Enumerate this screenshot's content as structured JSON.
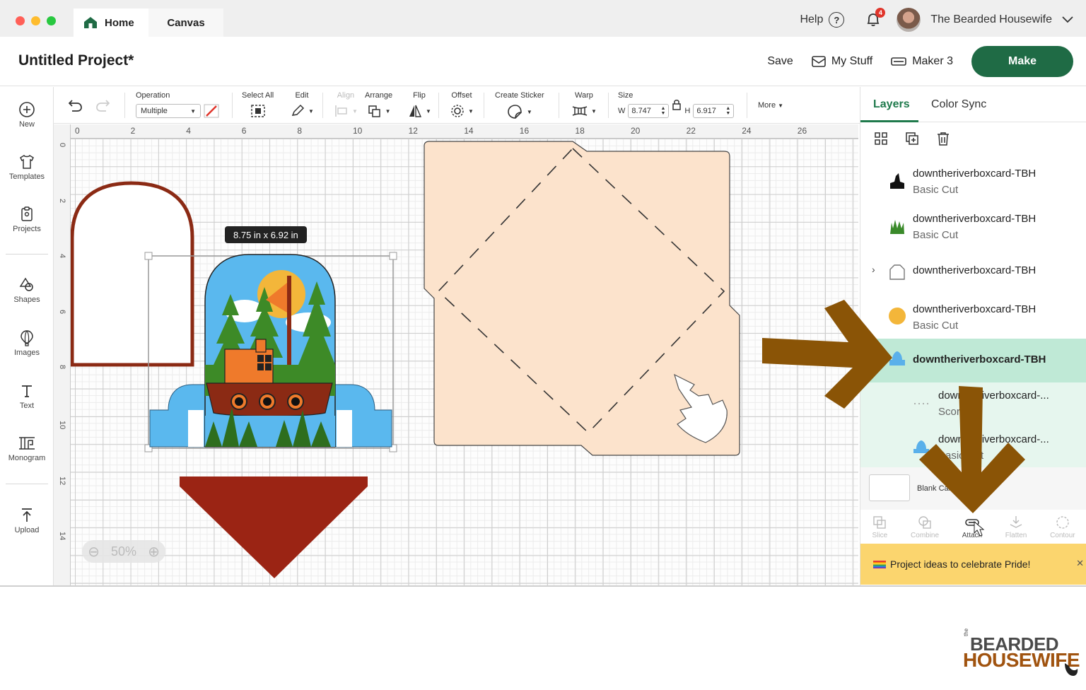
{
  "tabbar": {
    "home_label": "Home",
    "canvas_label": "Canvas",
    "help_label": "Help",
    "notification_count": "4",
    "user_name": "The Bearded Housewife"
  },
  "header": {
    "project_title": "Untitled Project*",
    "save_label": "Save",
    "mystuff_label": "My Stuff",
    "machine_label": "Maker 3",
    "make_label": "Make"
  },
  "sidebar": {
    "items": [
      {
        "label": "New"
      },
      {
        "label": "Templates"
      },
      {
        "label": "Projects"
      },
      {
        "label": "Shapes"
      },
      {
        "label": "Images"
      },
      {
        "label": "Text"
      },
      {
        "label": "Monogram"
      },
      {
        "label": "Upload"
      }
    ]
  },
  "toolbar": {
    "operation_label": "Operation",
    "operation_value": "Multiple",
    "selectall_label": "Select All",
    "edit_label": "Edit",
    "align_label": "Align",
    "arrange_label": "Arrange",
    "flip_label": "Flip",
    "offset_label": "Offset",
    "sticker_label": "Create Sticker",
    "warp_label": "Warp",
    "size_label": "Size",
    "w_label": "W",
    "w_value": "8.747",
    "h_label": "H",
    "h_value": "6.917",
    "more_label": "More"
  },
  "canvas": {
    "ruler_top": [
      "0",
      "2",
      "4",
      "6",
      "8",
      "10",
      "12",
      "14",
      "16",
      "18",
      "20",
      "22",
      "24",
      "26"
    ],
    "ruler_left": [
      "0",
      "2",
      "4",
      "6",
      "8",
      "10",
      "12",
      "14"
    ],
    "size_tooltip": "8.75  in x 6.92  in",
    "zoom_value": "50%"
  },
  "right_panel": {
    "tabs": [
      "Layers",
      "Color Sync"
    ],
    "layers": [
      {
        "name": "downtheriverboxcard-TBH",
        "sub": "Basic Cut",
        "color": "#111111"
      },
      {
        "name": "downtheriverboxcard-TBH",
        "sub": "Basic Cut",
        "color": "#3a8a2a"
      },
      {
        "name": "downtheriverboxcard-TBH",
        "sub": "",
        "color": "#888888"
      },
      {
        "name": "downtheriverboxcard-TBH",
        "sub": "Basic Cut",
        "color": "#f3b63a"
      },
      {
        "name": "downtheriverboxcard-TBH",
        "sub": "",
        "color": "#5ab0ea"
      },
      {
        "name": "downtheriverboxcard-...",
        "sub": "Score",
        "color": "#999999"
      },
      {
        "name": "downtheriverboxcard-...",
        "sub": "Basic Cut",
        "color": "#5ab0ea"
      }
    ],
    "blank_label": "Blank Canvas",
    "actions": [
      "Slice",
      "Combine",
      "Attach",
      "Flatten",
      "Contour"
    ],
    "promo_text": "Project ideas to celebrate Pride!"
  },
  "colors": {
    "brand_green": "#1f6b45",
    "arrow_brown": "#8a5406",
    "selected_layer": "#bfe9d6"
  },
  "watermark": {
    "line1": "BEARDED",
    "line2": "HOUSEWIFE",
    "small": "the"
  }
}
